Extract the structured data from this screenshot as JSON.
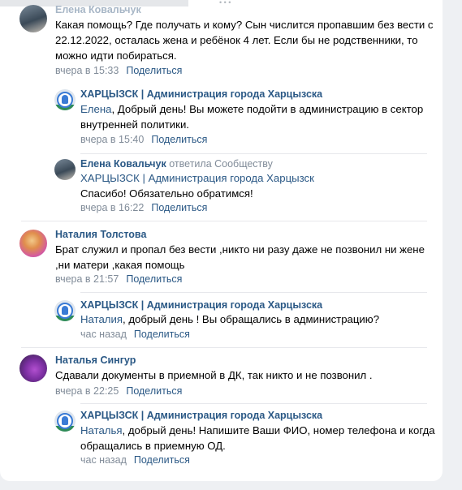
{
  "top_comment": {
    "author_partial": "Елена Ковальчук",
    "lines": [
      "Какая помощь? Где получать и кому? Сын числится пропавшим без вести с",
      "22.12.2022, осталась жена и ребёнок 4 лет. Если бы не родственники, то",
      "можно идти побираться."
    ],
    "time": "вчера в 15:33",
    "share": "Поделиться"
  },
  "reply_1": {
    "author": "ХАРЦЫЗСК | Администрация города Харцызска",
    "mention": "Елена",
    "lines": [
      ", Добрый день! Вы можете подойти в администрацию в сектор",
      "внутренней политики."
    ],
    "time": "вчера в 15:40",
    "share": "Поделиться"
  },
  "reply_2": {
    "author": "Елена Ковальчук",
    "author_suffix": " ответила Сообществу",
    "mention": "ХАРЦЫЗСК | Администрация города Харцызск",
    "line": "Спасибо! Обязательно обратимся!",
    "time": "вчера в 16:22",
    "share": "Поделиться"
  },
  "comment_2": {
    "author": "Наталия Толстова",
    "lines": [
      "Брат служил и пропал без вести ,никто ни разу даже не позвонил ни жене",
      ",ни матери ,какая помощь"
    ],
    "time": "вчера в 21:57",
    "share": "Поделиться"
  },
  "reply_3": {
    "author": "ХАРЦЫЗСК | Администрация города Харцызска",
    "mention": "Наталия",
    "line": ", добрый день ! Вы обращались в администрацию?",
    "time": "час назад",
    "share": "Поделиться"
  },
  "comment_3": {
    "author": "Наталья Сингур",
    "line": "Сдавали документы в приемной в ДК, так никто и не позвонил .",
    "time": "вчера в 22:25",
    "share": "Поделиться"
  },
  "reply_4": {
    "author": "ХАРЦЫЗСК | Администрация города Харцызска",
    "mention": "Наталья",
    "lines": [
      ", добрый день! Напишите Ваши ФИО, номер телефона и когда",
      "обращались в приемную ОД."
    ],
    "time": "час назад",
    "share": "Поделиться"
  },
  "colors": {
    "link": "#2a5885",
    "muted": "#818c99",
    "background": "#eef0f3",
    "card": "#ffffff"
  },
  "icons": [
    "admin-logo-avatar",
    "user-avatar"
  ]
}
